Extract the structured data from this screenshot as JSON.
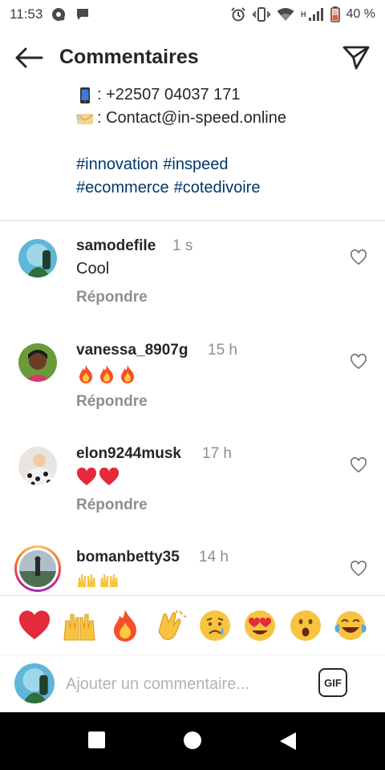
{
  "status_bar": {
    "time": "11:53",
    "network_label": "H",
    "battery": "40 %"
  },
  "header": {
    "title": "Commentaires"
  },
  "caption": {
    "phone": ": +22507 04037 171",
    "email": ": Contact@in-speed.online",
    "hashtags_line1": [
      "#innovation",
      "#inspeed"
    ],
    "hashtags_line2": [
      "#ecommerce",
      "#cotedivoire"
    ]
  },
  "comments": [
    {
      "username": "samodefile",
      "time": "1 s",
      "text": "Cool",
      "reply_label": "Répondre"
    },
    {
      "username": "vanessa_8907g",
      "time": "15 h",
      "text": "",
      "emojis": [
        "fire",
        "fire",
        "fire"
      ],
      "reply_label": "Répondre"
    },
    {
      "username": "elon9244musk",
      "time": "17 h",
      "text": "",
      "emojis": [
        "heart",
        "heart"
      ],
      "reply_label": "Répondre"
    },
    {
      "username": "bomanbetty35",
      "time": "14 h",
      "text": "",
      "emojis": [
        "raised-hands",
        "raised-hands"
      ],
      "reply_label": ""
    }
  ],
  "reactions": [
    "red-heart",
    "raised-hands",
    "fire",
    "clapping-hands",
    "crying-face",
    "heart-eyes-face",
    "surprised-face",
    "tears-of-joy-face"
  ],
  "composer": {
    "placeholder": "Ajouter un commentaire...",
    "gif_label": "GIF"
  },
  "colors": {
    "text": "#262626",
    "muted": "#8e8e8e",
    "hashtag": "#00376b",
    "divider": "#dbdbdb"
  }
}
